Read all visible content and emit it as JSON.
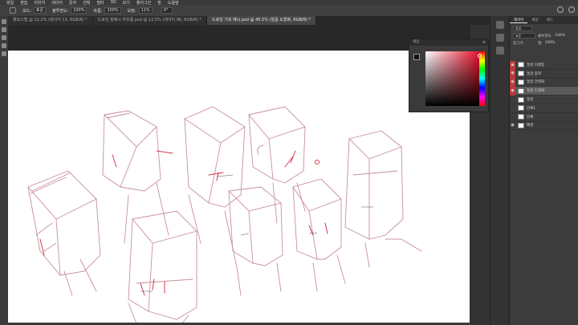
{
  "menubar": {
    "items": [
      "파일",
      "편집",
      "이미지",
      "레이어",
      "문자",
      "선택",
      "필터",
      "3D",
      "보기",
      "플러그인",
      "창",
      "도움말"
    ]
  },
  "options": {
    "mode_label": "모드:",
    "mode_value": "표준",
    "opacity_label": "불투명도:",
    "opacity_value": "100%",
    "flow_label": "흐름:",
    "flow_value": "100%",
    "smooth_label": "보정:",
    "smooth_value": "11%",
    "angle_value": "0°"
  },
  "tabs": [
    {
      "label": "풀모스텝 @ 22.2% (레이어 13, RGB/8) *",
      "active": false
    },
    {
      "label": "드로잉 참패시 자유롭 psd @ 12.5% (레이어 96, RGB/8) *",
      "active": false
    },
    {
      "label": "드로잉 기초 예시.psd @ 45.5% (얼굴 도형화, RGB/8) *",
      "active": true
    }
  ],
  "swatches": {
    "title": "색상"
  },
  "layers": {
    "tabs": [
      "레이어",
      "채널",
      "패스"
    ],
    "kind_value": "종류",
    "blend_value": "표준",
    "opacity_label": "불투명도:",
    "opacity_value": "100%",
    "lock_label": "잠그기:",
    "fill_label": "칠:",
    "fill_value": "100%",
    "items": [
      {
        "name": "얼굴 디테일",
        "eye": true,
        "red": true,
        "selected": false
      },
      {
        "name": "얼굴 중학",
        "eye": true,
        "red": true,
        "selected": false
      },
      {
        "name": "얼굴 간략화",
        "eye": true,
        "red": true,
        "selected": false
      },
      {
        "name": "얼굴 도형화",
        "eye": true,
        "red": true,
        "selected": true
      },
      {
        "name": "얼굴",
        "eye": false,
        "red": false,
        "selected": false
      },
      {
        "name": "인체1",
        "eye": false,
        "red": false,
        "selected": false
      },
      {
        "name": "인체",
        "eye": false,
        "red": false,
        "selected": false
      },
      {
        "name": "배경",
        "eye": true,
        "red": false,
        "selected": false
      }
    ]
  },
  "colors": {
    "sketch": "#c98f9e",
    "red_line": "#d23a4a",
    "canvas": "#ffffff"
  },
  "icons": [
    "brush-icon",
    "search-icon",
    "eye-icon",
    "menu-icon"
  ]
}
